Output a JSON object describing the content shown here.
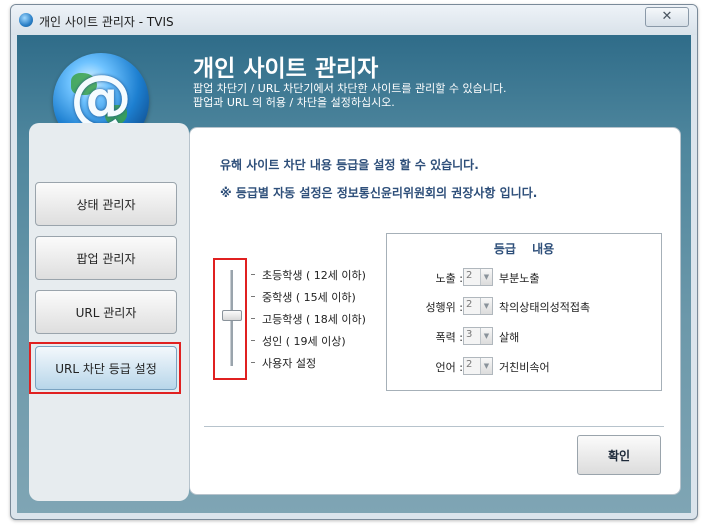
{
  "window": {
    "title": "개인 사이트 관리자 - TVIS",
    "close_glyph": "✕"
  },
  "header": {
    "logo_glyph": "@",
    "title": "개인 사이트 관리자",
    "subtitle_1": "팝업 차단기 / URL 차단기에서 차단한 사이트를 관리할 수 있습니다.",
    "subtitle_2": "팝업과 URL 의 허용 / 차단을 설정하십시오."
  },
  "nav": {
    "items": [
      {
        "label": "상태 관리자"
      },
      {
        "label": "팝업 관리자"
      },
      {
        "label": "URL 관리자"
      },
      {
        "label": "URL 차단 등급 설정"
      }
    ],
    "active_index": 3
  },
  "content": {
    "info_1": "유해 사이트 차단 내용 등급을 설정 할 수 있습니다.",
    "info_2": "※ 등급별 자동 설정은 정보통신윤리위원회의 권장사항 입니다.",
    "levels": [
      "초등학생 ( 12세 이하)",
      "중학생 ( 15세 이하)",
      "고등학생 ( 18세 이하)",
      "성인 ( 19세 이상)",
      "사용자 설정"
    ],
    "selected_level_index": 2,
    "grade_box": {
      "header": "등급 내용",
      "rows": [
        {
          "label": "노출 :",
          "value": "2",
          "desc": "부분노출"
        },
        {
          "label": "성행위 :",
          "value": "2",
          "desc": "착의상태의성적접촉"
        },
        {
          "label": "폭력 :",
          "value": "3",
          "desc": "살해"
        },
        {
          "label": "언어 :",
          "value": "2",
          "desc": "거친비속어"
        }
      ]
    },
    "ok_label": "확인"
  },
  "colors": {
    "accent_red": "#e02020",
    "header_teal": "#2f6c89",
    "info_text": "#2e4f7a"
  }
}
